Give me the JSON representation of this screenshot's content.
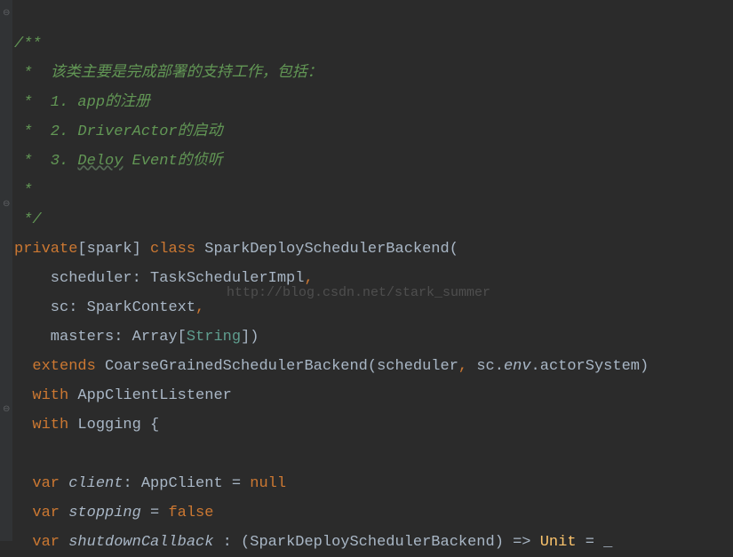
{
  "comment": {
    "l1": "/**",
    "l2": " *  该类主要是完成部署的支持工作，包括：",
    "l3": " *  1. app的注册",
    "l4": " *  2. DriverActor的启动",
    "l5_a": " *  3. ",
    "l5_b": "Deloy",
    "l5_c": " Event的侦听",
    "l6": " *",
    "l7": " */"
  },
  "kw": {
    "private": "private",
    "class": "class",
    "extends": "extends",
    "with": "with",
    "var": "var",
    "null": "null",
    "false": "false"
  },
  "decl": {
    "lbr_spark": "[spark] ",
    "className": "SparkDeploySchedulerBackend",
    "lparen": "(",
    "p1_name": "    scheduler",
    "p1_colon": ": ",
    "p1_type": "TaskSchedulerImpl",
    "comma": ",",
    "p2_name": "    sc",
    "p2_type": "SparkContext",
    "p3_name": "    masters",
    "p3_typeA": "Array",
    "p3_lbr": "[",
    "p3_typeB": "String",
    "p3_rbr": "]",
    "rparen": ")"
  },
  "ext": {
    "base": "CoarseGrainedSchedulerBackend",
    "args_a": "(scheduler",
    "args_b": " sc.",
    "env": "env",
    "args_c": ".actorSystem)",
    "with1": "AppClientListener",
    "with2": "Logging {"
  },
  "vars": {
    "client_name": "client",
    "client_type": ": AppClient = ",
    "stopping_name": "stopping",
    "eq": " = ",
    "cb_name": "shutdownCallback",
    "cb_sig_a": " : (SparkDeploySchedulerBackend) => ",
    "cb_unit": "Unit",
    "cb_sig_b": " = _"
  },
  "watermark": "http://blog.csdn.net/stark_summer"
}
